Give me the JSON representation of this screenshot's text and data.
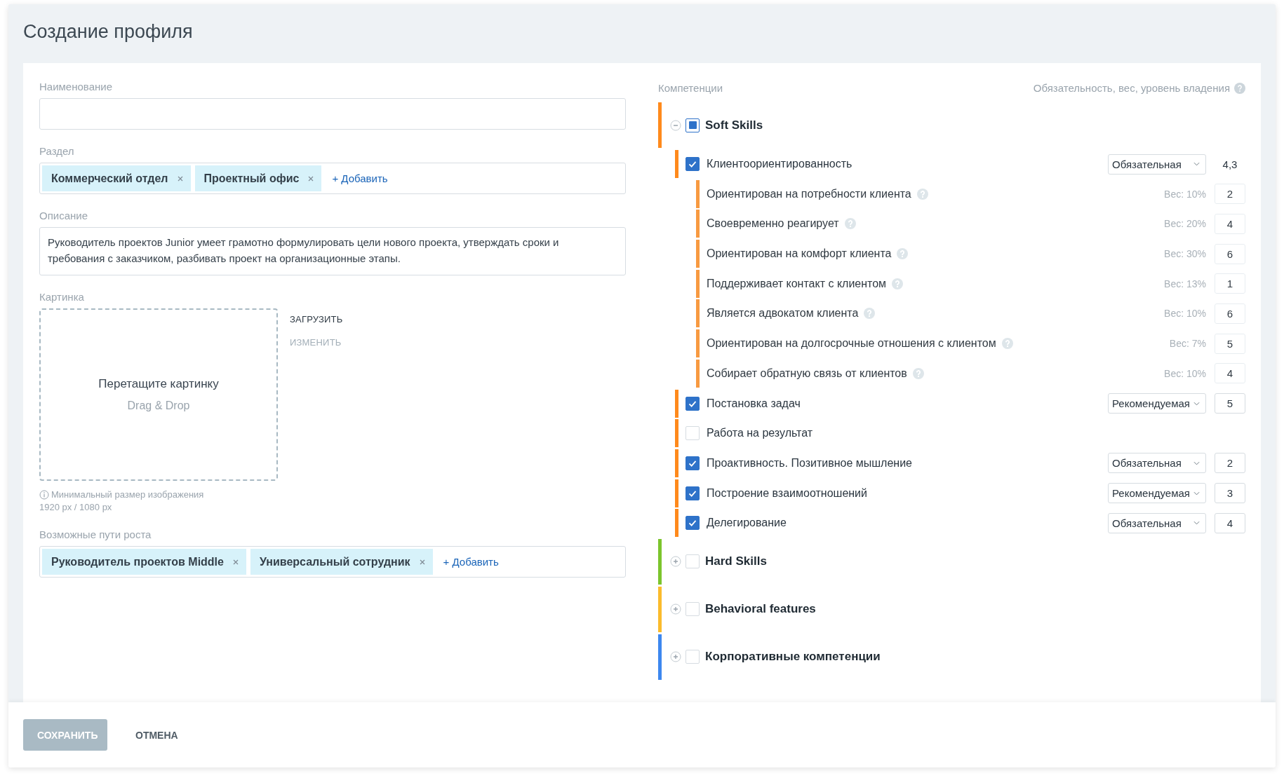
{
  "title": "Создание профиля",
  "name_field": {
    "label": "Наименование"
  },
  "section_field": {
    "label": "Раздел",
    "tags": [
      "Коммерческий отдел",
      "Проектный офис"
    ],
    "add_label": "+ Добавить"
  },
  "description_field": {
    "label": "Описание",
    "value": "Руководитель проектов Junior умеет грамотно формулировать цели нового проекта, утверждать сроки и требования с заказчиком, разбивать проект на организационные этапы."
  },
  "picture_field": {
    "label": "Картинка",
    "drop_title": "Перетащите картинку",
    "drop_hint": "Drag & Drop",
    "actions": [
      {
        "label": "ЗАГРУЗИТЬ",
        "disabled": false
      },
      {
        "label": "ИЗМЕНИТЬ",
        "disabled": true
      }
    ],
    "note": "Минимальный размер изображения",
    "note_size": "1920 px / 1080 px"
  },
  "growth_field": {
    "label": "Возможные пути роста",
    "tags": [
      "Руководитель проектов Middle",
      "Универсальный сотрудник"
    ],
    "add_label": "+ Добавить"
  },
  "competencies": {
    "label": "Компетенции",
    "hint": "Обязательность, вес, уровень владения",
    "groups": [
      {
        "name": "Soft Skills",
        "color": "#ff8a1c",
        "expanded": true,
        "checked": false,
        "partial": true,
        "items": [
          {
            "name": "Клиентоориентированность",
            "checked": true,
            "requirement": "Обязательная",
            "score": "4,3",
            "indicators": [
              {
                "name": "Ориентирован на потребности клиента",
                "weight": "Вес: 10%",
                "score": "2"
              },
              {
                "name": "Своевременно реагирует",
                "weight": "Вес: 20%",
                "score": "4"
              },
              {
                "name": "Ориентирован на комфорт клиента",
                "weight": "Вес: 30%",
                "score": "6"
              },
              {
                "name": "Поддерживает контакт с клиентом",
                "weight": "Вес: 13%",
                "score": "1"
              },
              {
                "name": "Является адвокатом клиента",
                "weight": "Вес: 10%",
                "score": "6"
              },
              {
                "name": "Ориентирован на долгосрочные отношения с клиентом",
                "weight": "Вес: 7%",
                "score": "5"
              },
              {
                "name": "Собирает обратную связь от клиентов",
                "weight": "Вес: 10%",
                "score": "4"
              }
            ]
          },
          {
            "name": "Постановка задач",
            "checked": true,
            "requirement": "Рекомендуемая",
            "score": "5"
          },
          {
            "name": "Работа на результат",
            "checked": false
          },
          {
            "name": "Проактивность. Позитивное мышление",
            "checked": true,
            "requirement": "Обязательная",
            "score": "2"
          },
          {
            "name": "Построение взаимоотношений",
            "checked": true,
            "requirement": "Рекомендуемая",
            "score": "3"
          },
          {
            "name": "Делегирование",
            "checked": true,
            "requirement": "Обязательная",
            "score": "4"
          }
        ]
      },
      {
        "name": "Hard Skills",
        "color": "#7cc52c",
        "expanded": false,
        "checked": false,
        "partial": false
      },
      {
        "name": "Behavioral features",
        "color": "#fbbb2c",
        "expanded": false,
        "checked": false,
        "partial": false
      },
      {
        "name": "Корпоративные компетенции",
        "color": "#3d87ef",
        "expanded": false,
        "checked": false,
        "partial": false
      }
    ]
  },
  "footer_buttons": [
    {
      "label": "СОХРАНИТЬ",
      "kind": "primary",
      "disabled": true
    },
    {
      "label": "ОТМЕНА",
      "kind": "text",
      "disabled": false
    }
  ]
}
